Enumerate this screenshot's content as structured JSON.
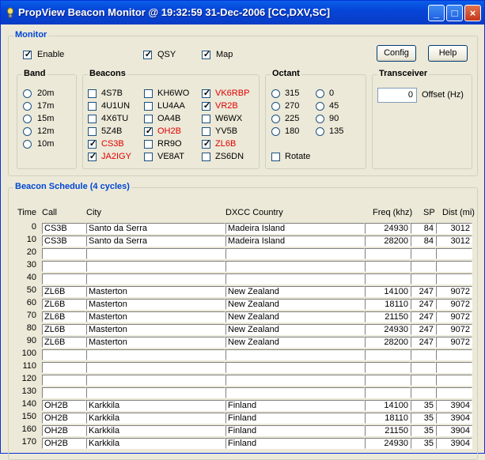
{
  "window": {
    "title": "PropView Beacon Monitor @ 19:32:59 31-Dec-2006 [CC,DXV,SC]"
  },
  "monitor": {
    "title": "Monitor",
    "enable": {
      "label": "Enable",
      "checked": true
    },
    "qsy": {
      "label": "QSY",
      "checked": true
    },
    "map": {
      "label": "Map",
      "checked": true
    },
    "config_label": "Config",
    "help_label": "Help"
  },
  "band": {
    "title": "Band",
    "options": [
      "20m",
      "17m",
      "15m",
      "12m",
      "10m"
    ]
  },
  "beacons": {
    "title": "Beacons",
    "items": [
      {
        "label": "4S7B",
        "checked": false,
        "highlight": false
      },
      {
        "label": "4U1UN",
        "checked": false,
        "highlight": false
      },
      {
        "label": "4X6TU",
        "checked": false,
        "highlight": false
      },
      {
        "label": "5Z4B",
        "checked": false,
        "highlight": false
      },
      {
        "label": "CS3B",
        "checked": true,
        "highlight": true
      },
      {
        "label": "JA2IGY",
        "checked": true,
        "highlight": true
      },
      {
        "label": "KH6WO",
        "checked": false,
        "highlight": false
      },
      {
        "label": "LU4AA",
        "checked": false,
        "highlight": false
      },
      {
        "label": "OA4B",
        "checked": false,
        "highlight": false
      },
      {
        "label": "OH2B",
        "checked": true,
        "highlight": true
      },
      {
        "label": "RR9O",
        "checked": false,
        "highlight": false
      },
      {
        "label": "VE8AT",
        "checked": false,
        "highlight": false
      },
      {
        "label": "VK6RBP",
        "checked": true,
        "highlight": true
      },
      {
        "label": "VR2B",
        "checked": true,
        "highlight": true
      },
      {
        "label": "W6WX",
        "checked": false,
        "highlight": false
      },
      {
        "label": "YV5B",
        "checked": false,
        "highlight": false
      },
      {
        "label": "ZL6B",
        "checked": true,
        "highlight": true
      },
      {
        "label": "ZS6DN",
        "checked": false,
        "highlight": false
      }
    ]
  },
  "octant": {
    "title": "Octant",
    "options": [
      "315",
      "0",
      "270",
      "45",
      "225",
      "90",
      "180",
      "135"
    ],
    "rotate": {
      "label": "Rotate",
      "checked": false
    }
  },
  "transceiver": {
    "title": "Transceiver",
    "offset_value": "0",
    "offset_label": "Offset (Hz)"
  },
  "schedule": {
    "title": "Beacon Schedule (4 cycles)",
    "headers": {
      "time": "Time",
      "call": "Call",
      "city": "City",
      "country": "DXCC Country",
      "freq": "Freq (khz)",
      "sp": "SP",
      "dist": "Dist (mi)"
    },
    "rows": [
      {
        "time": "0",
        "call": "CS3B",
        "city": "Santo da Serra",
        "country": "Madeira Island",
        "freq": "24930",
        "sp": "84",
        "dist": "3012"
      },
      {
        "time": "10",
        "call": "CS3B",
        "city": "Santo da Serra",
        "country": "Madeira Island",
        "freq": "28200",
        "sp": "84",
        "dist": "3012"
      },
      {
        "time": "20",
        "call": "",
        "city": "",
        "country": "",
        "freq": "",
        "sp": "",
        "dist": ""
      },
      {
        "time": "30",
        "call": "",
        "city": "",
        "country": "",
        "freq": "",
        "sp": "",
        "dist": ""
      },
      {
        "time": "40",
        "call": "",
        "city": "",
        "country": "",
        "freq": "",
        "sp": "",
        "dist": ""
      },
      {
        "time": "50",
        "call": "ZL6B",
        "city": "Masterton",
        "country": "New Zealand",
        "freq": "14100",
        "sp": "247",
        "dist": "9072"
      },
      {
        "time": "60",
        "call": "ZL6B",
        "city": "Masterton",
        "country": "New Zealand",
        "freq": "18110",
        "sp": "247",
        "dist": "9072"
      },
      {
        "time": "70",
        "call": "ZL6B",
        "city": "Masterton",
        "country": "New Zealand",
        "freq": "21150",
        "sp": "247",
        "dist": "9072"
      },
      {
        "time": "80",
        "call": "ZL6B",
        "city": "Masterton",
        "country": "New Zealand",
        "freq": "24930",
        "sp": "247",
        "dist": "9072"
      },
      {
        "time": "90",
        "call": "ZL6B",
        "city": "Masterton",
        "country": "New Zealand",
        "freq": "28200",
        "sp": "247",
        "dist": "9072"
      },
      {
        "time": "100",
        "call": "",
        "city": "",
        "country": "",
        "freq": "",
        "sp": "",
        "dist": ""
      },
      {
        "time": "110",
        "call": "",
        "city": "",
        "country": "",
        "freq": "",
        "sp": "",
        "dist": ""
      },
      {
        "time": "120",
        "call": "",
        "city": "",
        "country": "",
        "freq": "",
        "sp": "",
        "dist": ""
      },
      {
        "time": "130",
        "call": "",
        "city": "",
        "country": "",
        "freq": "",
        "sp": "",
        "dist": ""
      },
      {
        "time": "140",
        "call": "OH2B",
        "city": "Karkkila",
        "country": "Finland",
        "freq": "14100",
        "sp": "35",
        "dist": "3904"
      },
      {
        "time": "150",
        "call": "OH2B",
        "city": "Karkkila",
        "country": "Finland",
        "freq": "18110",
        "sp": "35",
        "dist": "3904"
      },
      {
        "time": "160",
        "call": "OH2B",
        "city": "Karkkila",
        "country": "Finland",
        "freq": "21150",
        "sp": "35",
        "dist": "3904"
      },
      {
        "time": "170",
        "call": "OH2B",
        "city": "Karkkila",
        "country": "Finland",
        "freq": "24930",
        "sp": "35",
        "dist": "3904"
      }
    ]
  },
  "colors": {
    "highlight": "#e00000",
    "group_title": "#0046d5",
    "titlebar": "#0545d8"
  }
}
